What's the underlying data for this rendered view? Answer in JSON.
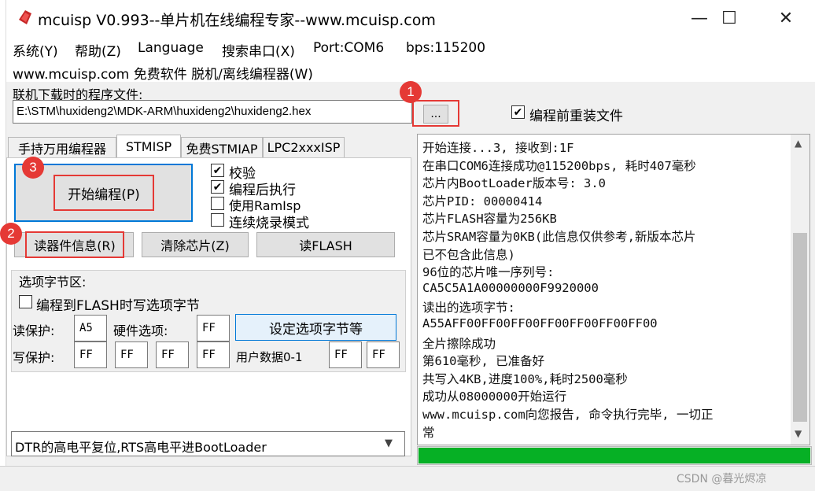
{
  "window": {
    "title": "mcuisp V0.993--单片机在线编程专家--www.mcuisp.com",
    "minimize": "—",
    "maximize": "☐",
    "close": "✕"
  },
  "menu": {
    "items": [
      "系统(Y)",
      "帮助(Z)",
      "Language",
      "搜索串口(X)",
      "Port:COM6",
      "bps:115200"
    ],
    "second_row": "www.mcuisp.com 免费软件 脱机/离线编程器(W)"
  },
  "file": {
    "label": "联机下载时的程序文件:",
    "path": "E:\\STM\\huxideng2\\MDK-ARM\\huxideng2\\huxideng2.hex",
    "browse_label": "...",
    "reload_label": "编程前重装文件",
    "reload_checked": true
  },
  "badges": [
    "1",
    "2",
    "3"
  ],
  "tabs": [
    "手持万用编程器",
    "STMISP",
    "免费STMIAP",
    "LPC2xxxISP"
  ],
  "active_tab": "STMISP",
  "buttons": {
    "start": "开始编程(P)",
    "read_info": "读器件信息(R)",
    "clear_chip": "清除芯片(Z)",
    "read_flash": "读FLASH",
    "set_option": "设定选项字节等"
  },
  "checks": [
    {
      "label": "校验",
      "checked": true
    },
    {
      "label": "编程后执行",
      "checked": true
    },
    {
      "label": "使用RamIsp",
      "checked": false
    },
    {
      "label": "连续烧录模式",
      "checked": false
    }
  ],
  "options": {
    "group_label": "选项字节区:",
    "write_option_label": "编程到FLASH时写选项字节",
    "write_option_checked": false,
    "read_protect_label": "读保护:",
    "read_protect_value": "A5",
    "hw_option_label": "硬件选项:",
    "hw_option_value": "FF",
    "write_protect_label": "写保护:",
    "write_protect_values": [
      "FF",
      "FF",
      "FF",
      "FF"
    ],
    "user_data_label": "用户数据0-1",
    "user_data_values": [
      "FF",
      "FF"
    ]
  },
  "boot_mode": "DTR的高电平复位,RTS高电平进BootLoader",
  "log": [
    "开始连接...3, 接收到:1F",
    "在串口COM6连接成功@115200bps, 耗时407毫秒",
    "芯片内BootLoader版本号: 3.0",
    "芯片PID: 00000414",
    "芯片FLASH容量为256KB",
    "芯片SRAM容量为0KB(此信息仅供参考,新版本芯片",
    "已不包含此信息)",
    "96位的芯片唯一序列号:",
    "CA5C5A1A00000000F9920000",
    "读出的选项字节:",
    "A55AFF00FF00FF00FF00FF00FF00FF00",
    "全片擦除成功",
    "第610毫秒, 已准备好",
    "共写入4KB,进度100%,耗时2500毫秒",
    "成功从08000000开始运行",
    "www.mcuisp.com向您报告, 命令执行完毕, 一切正",
    "常"
  ],
  "progress_percent": 100,
  "watermark": "CSDN @暮光烬凉"
}
